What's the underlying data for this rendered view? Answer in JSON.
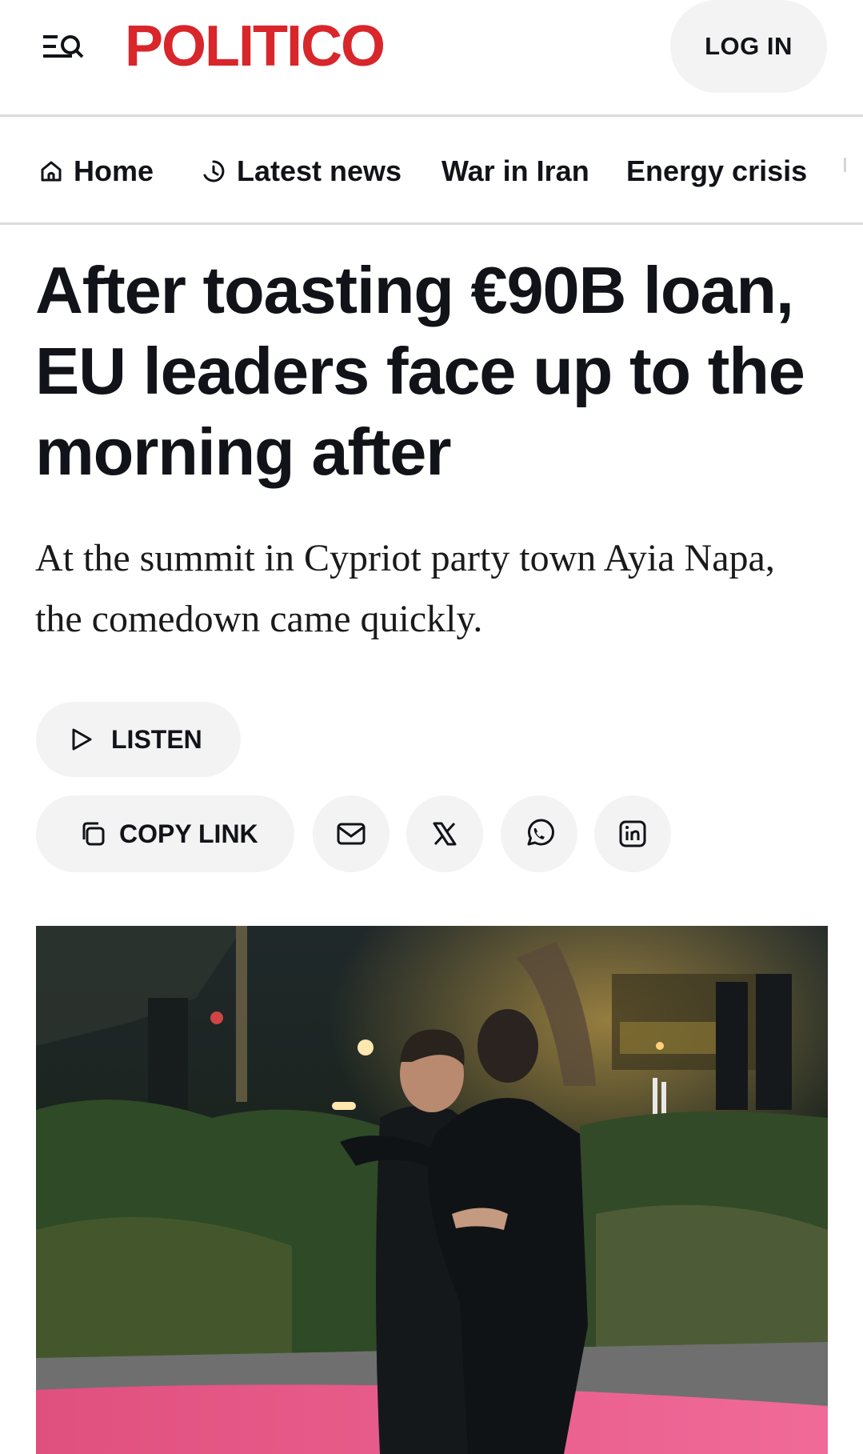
{
  "header": {
    "logo": "POLITICO",
    "login_label": "LOG IN",
    "brand_color": "#d8262b"
  },
  "nav": {
    "items": [
      {
        "label": "Home",
        "icon": "home-icon"
      },
      {
        "label": "Latest news",
        "icon": "clock-icon"
      },
      {
        "label": "War in Iran"
      },
      {
        "label": "Energy crisis"
      }
    ]
  },
  "article": {
    "headline": "After toasting €90B loan, EU leaders face up to the morning after",
    "dek": "At the summit in Cypriot party town Ayia Napa, the comedown came quickly.",
    "listen_label": "LISTEN",
    "copy_link_label": "COPY LINK",
    "share_icons": [
      "email-icon",
      "x-icon",
      "whatsapp-icon",
      "linkedin-icon"
    ]
  }
}
